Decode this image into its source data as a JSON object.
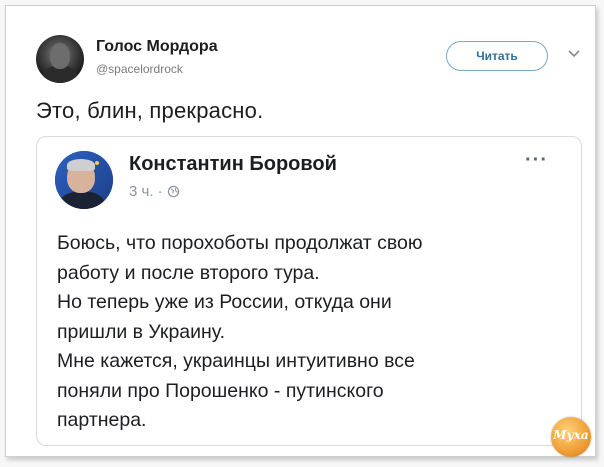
{
  "tweet": {
    "author_name": "Голос Мордора",
    "author_handle": "@spacelordrock",
    "follow_label": "Читать",
    "text": "Это, блин, прекрасно."
  },
  "quoted_post": {
    "author_name": "Константин Боровой",
    "time": "3 ч. ·",
    "more_label": "···",
    "lines": [
      "Боюсь, что порохоботы продолжат свою",
      "работу и после второго тура.",
      "Но теперь уже из России, откуда они",
      "пришли в Украину.",
      "Мне кажется, украинцы интуитивно все",
      "поняли про Порошенко - путинского",
      "партнера."
    ]
  },
  "watermark": {
    "text": "Муха"
  },
  "colors": {
    "follow_border": "#7aa7c7",
    "follow_text": "#2f6f99",
    "meta": "#8d949e"
  }
}
